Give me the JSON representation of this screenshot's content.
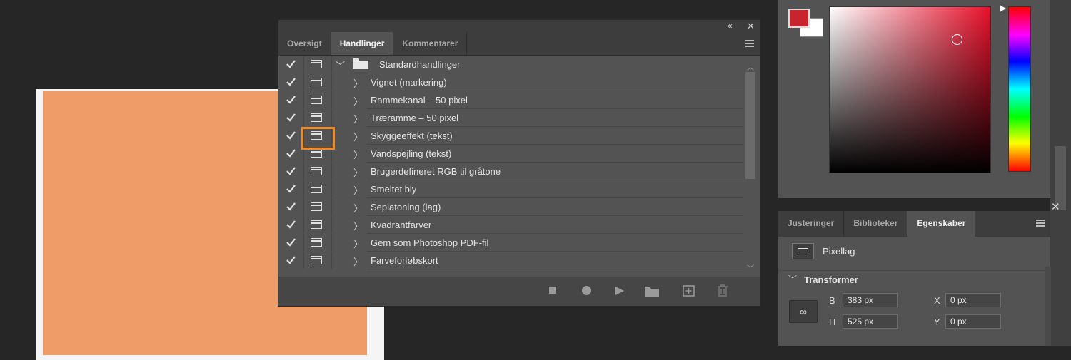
{
  "panel": {
    "collapse_icon": "«",
    "close_icon": "✕",
    "tabs": [
      {
        "label": "Oversigt",
        "active": false
      },
      {
        "label": "Handlinger",
        "active": true
      },
      {
        "label": "Kommentarer",
        "active": false
      }
    ],
    "set_name": "Standardhandlinger",
    "actions": [
      {
        "label": "Vignet (markering)"
      },
      {
        "label": "Rammekanal – 50 pixel"
      },
      {
        "label": "Træramme – 50 pixel"
      },
      {
        "label": "Skyggeeffekt (tekst)"
      },
      {
        "label": "Vandspejling (tekst)"
      },
      {
        "label": "Brugerdefineret RGB til gråtone"
      },
      {
        "label": "Smeltet bly"
      },
      {
        "label": "Sepiatoning (lag)"
      },
      {
        "label": "Kvadrantfarver"
      },
      {
        "label": "Gem som Photoshop PDF-fil"
      },
      {
        "label": "Farveforløbskort"
      }
    ],
    "bottom_icons": [
      "stop-icon",
      "record-icon",
      "play-icon",
      "new-set-icon",
      "new-action-icon",
      "trash-icon"
    ]
  },
  "color": {
    "foreground": "#c8242e",
    "background": "#ffffff"
  },
  "properties": {
    "tabs": [
      {
        "label": "Justeringer",
        "active": false
      },
      {
        "label": "Biblioteker",
        "active": false
      },
      {
        "label": "Egenskaber",
        "active": true
      }
    ],
    "layer_type": "Pixellag",
    "section_title": "Transformer",
    "fields": {
      "w_label": "B",
      "w_value": "383 px",
      "h_label": "H",
      "h_value": "525 px",
      "x_label": "X",
      "x_value": "0 px",
      "y_label": "Y",
      "y_value": "0 px"
    }
  }
}
